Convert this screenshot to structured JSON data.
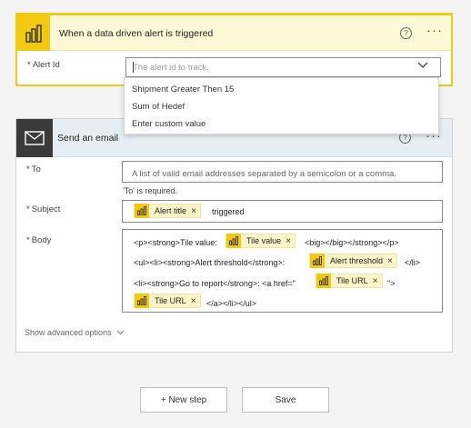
{
  "trigger": {
    "title": "When a data driven alert is triggered",
    "help_icon": "question-icon",
    "more_icon": "ellipsis-icon",
    "alert_id": {
      "label": "Alert Id",
      "required_marker": "*",
      "placeholder": "The alert id to track."
    },
    "dropdown_options": [
      "Shipment Greater Then 15",
      "Sum of Hedef",
      "Enter custom value"
    ]
  },
  "email": {
    "title": "Send an email",
    "to": {
      "label": "To",
      "required_marker": "*",
      "placeholder": "A list of valid email addresses separated by a semicolon or a comma.",
      "error": "'To' is required."
    },
    "subject": {
      "label": "Subject",
      "required_marker": "*",
      "token": "Alert title",
      "text": "triggered"
    },
    "body": {
      "label": "Body",
      "required_marker": "*",
      "line1_pre": "<p><strong>Tile value:",
      "line1_token": "Tile value",
      "line1_post": "<big></big></strong></p>",
      "line2_pre": "<ul><li><strong>Alert threshold</strong>:",
      "line2_token": "Alert threshold",
      "line2_post": "</li>",
      "line3_pre": "<li><strong>Go to report</strong>: <a href=\"",
      "line3_token": "Tile URL",
      "line3_post": "\">",
      "line4_token": "Tile URL",
      "line4_post": "</a></li></ul>"
    },
    "advanced": "Show advanced options"
  },
  "actions": {
    "new_step": "+ New step",
    "save": "Save"
  },
  "colors": {
    "powerbi_yellow": "#f2c811",
    "token_bg": "#fcf3c6",
    "email_header_bg": "#e6eef4",
    "email_icon_bg": "#3a3a3a"
  }
}
